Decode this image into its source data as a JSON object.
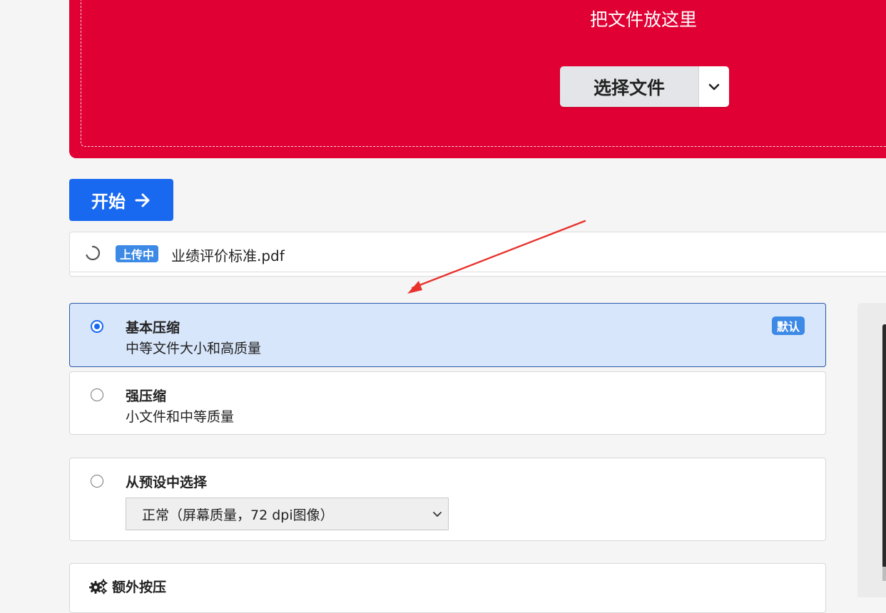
{
  "dropzone": {
    "drop_text": "把文件放这里",
    "choose_label": "选择文件",
    "background": "#e00034"
  },
  "start_button": {
    "label": "开始"
  },
  "upload": {
    "status_badge": "上传中",
    "filename": "业绩评价标准.pdf"
  },
  "options": [
    {
      "title": "基本压缩",
      "description": "中等文件大小和高质量",
      "badge": "默认",
      "selected": true
    },
    {
      "title": "强压缩",
      "description": "小文件和中等质量",
      "selected": false
    },
    {
      "title": "从预设中选择",
      "preset_value": "正常（屏幕质量，72 dpi图像）",
      "selected": false
    }
  ],
  "extra": {
    "title": "额外按压"
  },
  "colors": {
    "accent": "#1868f0",
    "badge": "#3c89e6",
    "selected_bg": "#d8e6fb",
    "annotation_arrow": "#e8322c"
  }
}
